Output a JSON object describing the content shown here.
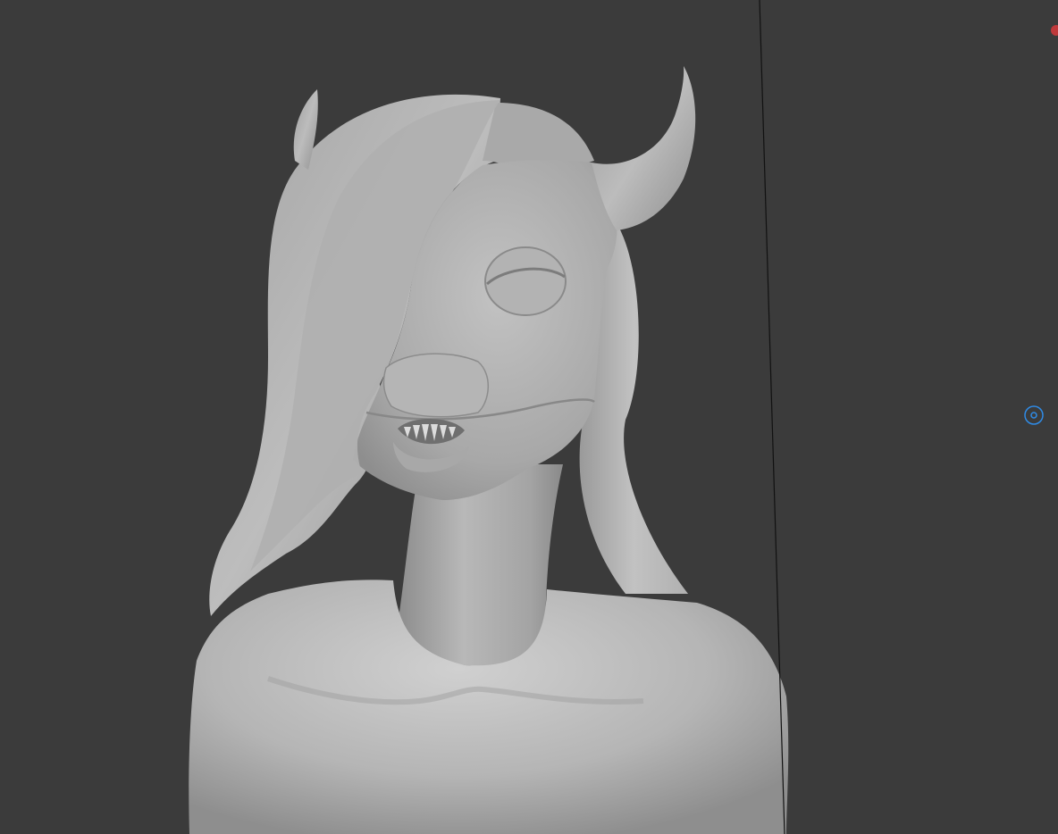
{
  "viewport": {
    "background_color": "#3b3b3b",
    "object": "sculpt-mesh-bust",
    "mesh_color": "#a9a9a9",
    "overlay_line_color": "#111111"
  },
  "gizmos": {
    "pivot": {
      "icon": "pivot-gizmo-icon",
      "color": "#2f8be6"
    },
    "marker": {
      "icon": "red-dot-icon",
      "color": "#c0393b"
    }
  }
}
